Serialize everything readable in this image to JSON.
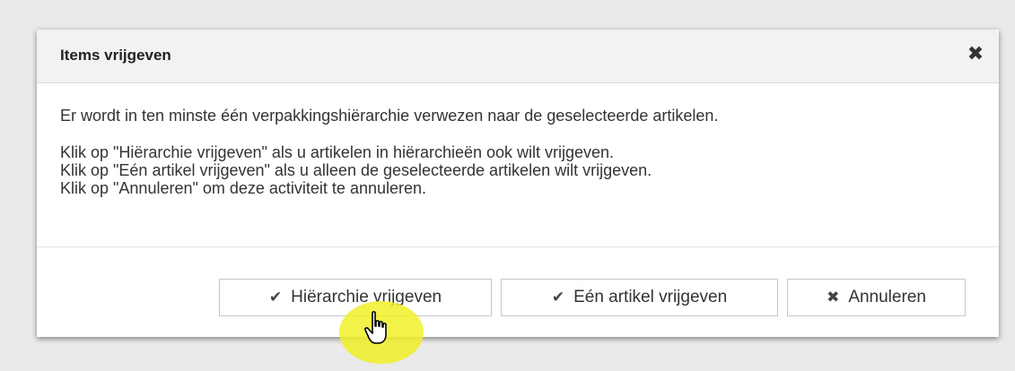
{
  "dialog": {
    "title": "Items vrijgeven",
    "close_icon": "close-icon",
    "intro": "Er wordt in ten minste één verpakkingshiërarchie verwezen naar de geselecteerde artikelen.",
    "instructions": [
      "Klik op \"Hiërarchie vrijgeven\" als u artikelen in hiërarchieën ook wilt vrijgeven.",
      "Klik op \"Eén artikel vrijgeven\" als u alleen de geselecteerde artikelen wilt vrijgeven.",
      "Klik op \"Annuleren\" om deze activiteit te annuleren."
    ],
    "buttons": {
      "release_hierarchy": {
        "label": "Hiërarchie vrijgeven",
        "icon": "check-icon"
      },
      "release_single": {
        "label": "Eén artikel vrijgeven",
        "icon": "check-icon"
      },
      "cancel": {
        "label": "Annuleren",
        "icon": "close-icon"
      }
    }
  },
  "colors": {
    "background": "#eaeaea",
    "header_background": "#f2f2f2",
    "cursor_highlight": "#f0f028"
  }
}
